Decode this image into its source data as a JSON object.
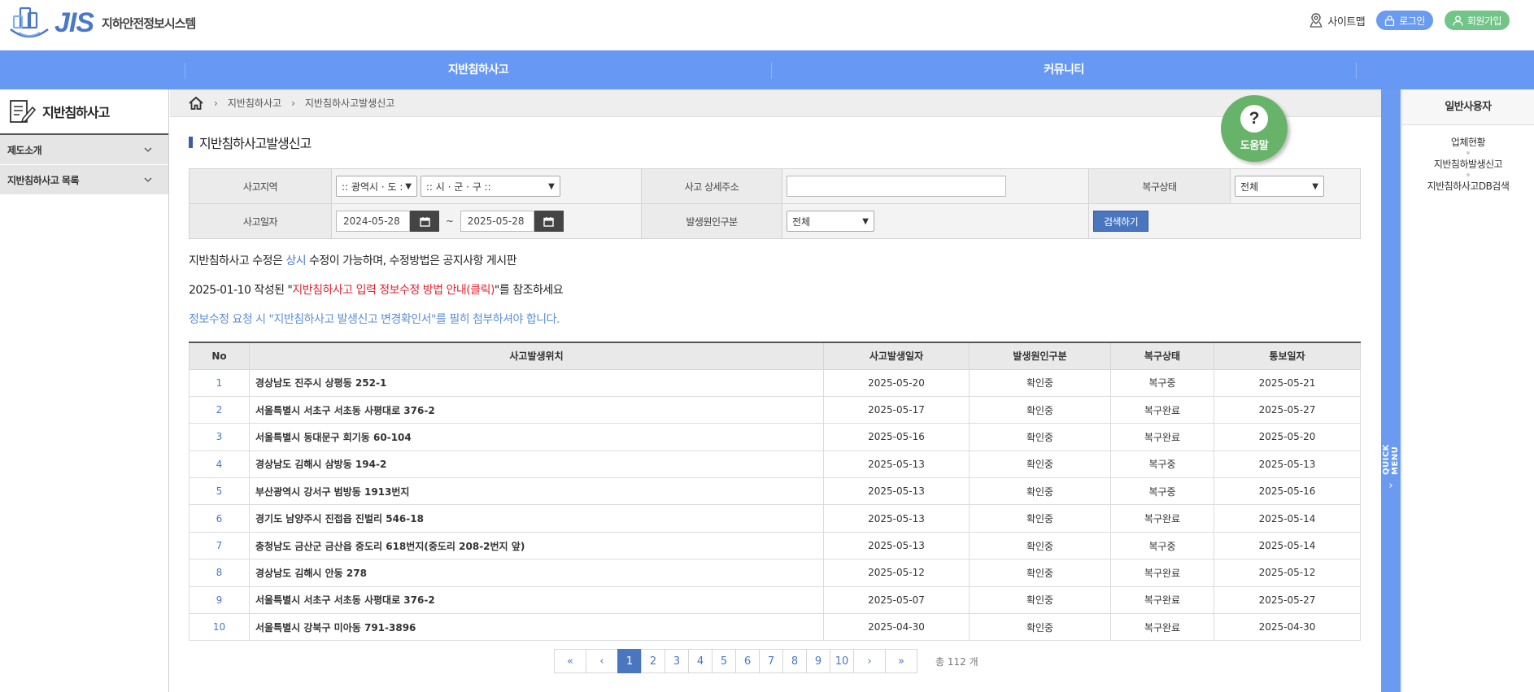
{
  "header": {
    "logo_text": "JIS",
    "logo_subtitle": "지하안전정보시스템",
    "sitemap_label": "사이트맵",
    "login_label": "로그인",
    "join_label": "회원가입"
  },
  "gnb": {
    "items": [
      "지반침하사고",
      "커뮤니티"
    ]
  },
  "lnb": {
    "title": "지반침하사고",
    "items": [
      "제도소개",
      "지반침하사고 목록"
    ]
  },
  "breadcrumb": [
    "지반침하사고",
    "지반침하사고발생신고"
  ],
  "help": {
    "label": "도움말",
    "symbol": "?"
  },
  "page_title": "지반침하사고발생신고",
  "search": {
    "region_label": "사고지역",
    "region_sido": ":: 광역시 · 도 ::",
    "region_sigungu": ":: 시 · 군 · 구 ::",
    "detail_label": "사고 상세주소",
    "detail_value": "",
    "recovery_label": "복구상태",
    "recovery_value": "전체",
    "date_label": "사고일자",
    "date_from": "2024-05-28",
    "date_sep": "~",
    "date_to": "2025-05-28",
    "cause_label": "발생원인구분",
    "cause_value": "전체",
    "search_button": "검색하기"
  },
  "notices": {
    "line1_a": "지반침하사고 수정은 ",
    "line1_b": "상시",
    "line1_c": " 수정이 가능하며, 수정방법은 공지사항 게시판",
    "line2_a": "2025-01-10 작성된 \"",
    "line2_b": "지반침하사고 입력 정보수정 방법 안내(클릭)",
    "line2_c": "\"를 참조하세요",
    "line3": "정보수정 요청 시 \"지반침하사고 발생신고 변경확인서\"를 필히 첨부하셔야 합니다."
  },
  "table": {
    "headers": [
      "No",
      "사고발생위치",
      "사고발생일자",
      "발생원인구분",
      "복구상태",
      "통보일자"
    ],
    "rows": [
      [
        "1",
        "경상남도 진주시 상평동 252-1",
        "2025-05-20",
        "확인중",
        "복구중",
        "2025-05-21"
      ],
      [
        "2",
        "서울특별시 서초구 서초동 사평대로 376-2",
        "2025-05-17",
        "확인중",
        "복구완료",
        "2025-05-27"
      ],
      [
        "3",
        "서울특별시 동대문구 회기동 60-104",
        "2025-05-16",
        "확인중",
        "복구완료",
        "2025-05-20"
      ],
      [
        "4",
        "경상남도 김해시 삼방동 194-2",
        "2025-05-13",
        "확인중",
        "복구중",
        "2025-05-13"
      ],
      [
        "5",
        "부산광역시 강서구 범방동 1913번지",
        "2025-05-13",
        "확인중",
        "복구중",
        "2025-05-16"
      ],
      [
        "6",
        "경기도 남양주시 진접읍 진벌리 546-18",
        "2025-05-13",
        "확인중",
        "복구완료",
        "2025-05-14"
      ],
      [
        "7",
        "충청남도 금산군 금산읍 중도리 618번지(중도리 208-2번지 앞)",
        "2025-05-13",
        "확인중",
        "복구중",
        "2025-05-14"
      ],
      [
        "8",
        "경상남도 김해시 안동 278",
        "2025-05-12",
        "확인중",
        "복구완료",
        "2025-05-12"
      ],
      [
        "9",
        "서울특별시 서초구 서초동 사평대로 376-2",
        "2025-05-07",
        "확인중",
        "복구완료",
        "2025-05-27"
      ],
      [
        "10",
        "서울특별시 강북구 미아동 791-3896",
        "2025-04-30",
        "확인중",
        "복구완료",
        "2025-04-30"
      ]
    ]
  },
  "pagination": {
    "first": "«",
    "prev": "‹",
    "pages": [
      "1",
      "2",
      "3",
      "4",
      "5",
      "6",
      "7",
      "8",
      "9",
      "10"
    ],
    "current": "1",
    "next": "›",
    "last": "»",
    "total": "총 112 개"
  },
  "quick": {
    "bar_label": "QUICK MENU",
    "arrow": "›",
    "panel_title": "일반사용자",
    "items": [
      "업체현황",
      "지반침하발생신고",
      "지반침하사고DB검색"
    ]
  },
  "colors": {
    "gnb": "#6799f4",
    "accent_blue": "#4a78c8",
    "accent_red": "#e0242e",
    "help_green": "#68b36a",
    "join_green": "#72c589"
  }
}
